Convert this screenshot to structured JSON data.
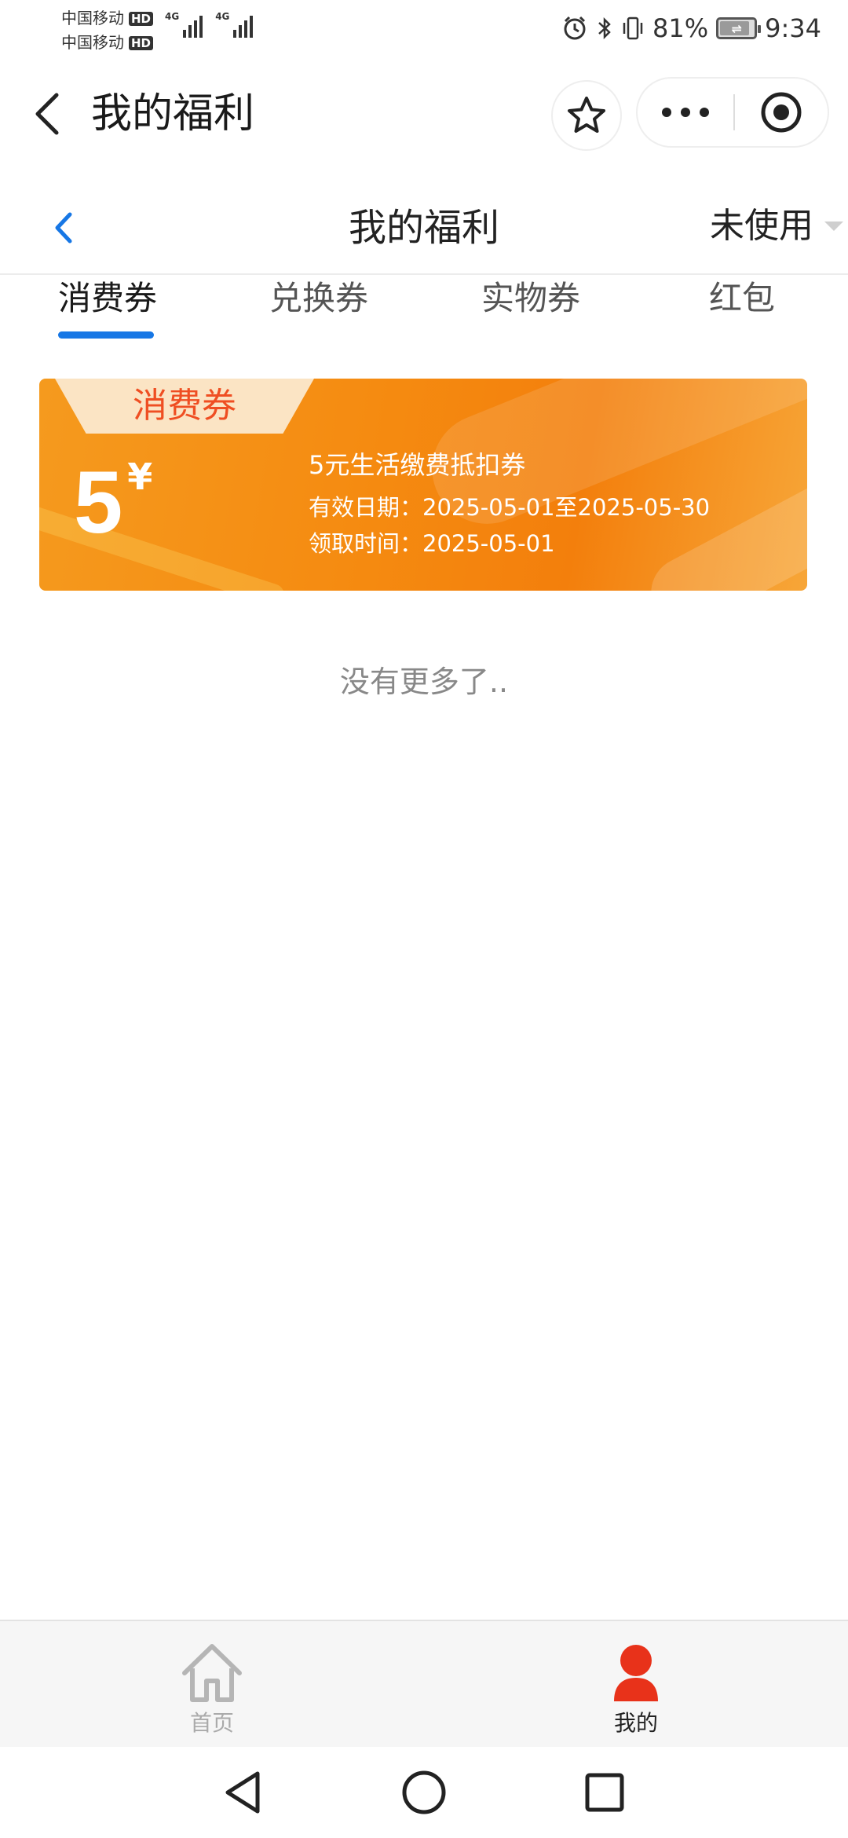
{
  "status_bar": {
    "carrier1": "中国移动",
    "carrier2": "中国移动",
    "hd": "HD",
    "network": "4G",
    "battery": "81%",
    "time": "9:34",
    "battery_level": 0.81
  },
  "header": {
    "title": "我的福利",
    "back_icon": "chevron-left-icon",
    "favorite_icon": "star-icon",
    "more_icon": "more-dots-icon",
    "close_icon": "target-icon"
  },
  "page": {
    "title": "我的福利",
    "filter": "未使用"
  },
  "tabs": [
    {
      "label": "消费券",
      "active": true
    },
    {
      "label": "兑换券",
      "active": false
    },
    {
      "label": "实物券",
      "active": false
    },
    {
      "label": "红包",
      "active": false
    }
  ],
  "coupons": [
    {
      "type_label": "消费券",
      "amount": "5",
      "currency": "¥",
      "name": "5元生活缴费抵扣券",
      "valid": "有效日期：2025-05-01至2025-05-30",
      "received": "领取时间：2025-05-01"
    }
  ],
  "no_more": "没有更多了..",
  "tabbar": {
    "home": "首页",
    "mine": "我的"
  },
  "colors": {
    "accent_blue": "#1777e5",
    "coupon_orange": "#f58a10",
    "coupon_tag_text": "#ef4e22",
    "mine_active": "#e8321a"
  }
}
